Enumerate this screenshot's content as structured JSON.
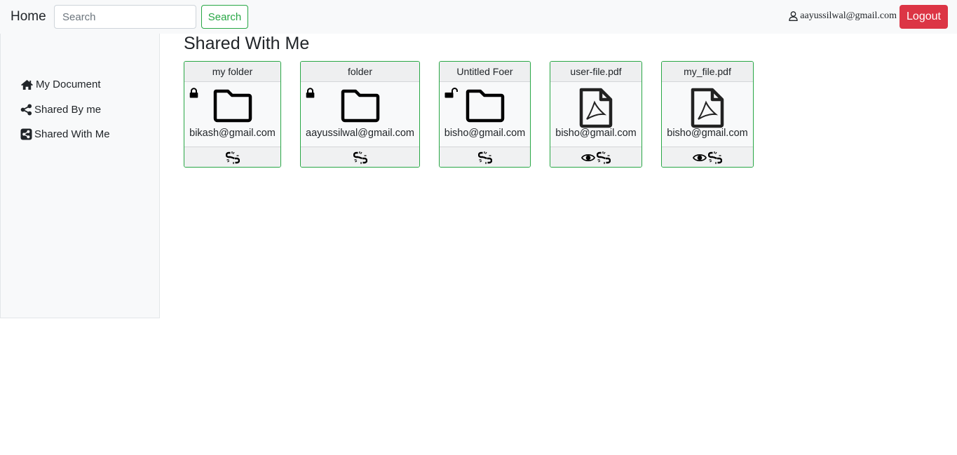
{
  "nav": {
    "brand": "Home",
    "search_placeholder": "Search",
    "search_button": "Search",
    "user_email": "aayussilwal@gmail.com",
    "logout_button": "Logout"
  },
  "sidebar": {
    "items": [
      {
        "label": "My Document",
        "icon": "home-icon"
      },
      {
        "label": "Shared By me",
        "icon": "share-icon"
      },
      {
        "label": "Shared With Me",
        "icon": "share-square-icon"
      }
    ]
  },
  "main": {
    "title": "Shared With Me",
    "cards": [
      {
        "name": "my folder",
        "owner": "bikash@gmail.com",
        "type": "folder",
        "lock": "locked-icon",
        "actions": [
          "unlink-icon"
        ]
      },
      {
        "name": "folder",
        "owner": "aayussilwal@gmail.com",
        "type": "folder",
        "lock": "locked-icon",
        "actions": [
          "unlink-icon"
        ]
      },
      {
        "name": "Untitled Foer",
        "owner": "bisho@gmail.com",
        "type": "folder",
        "lock": "unlocked-icon",
        "actions": [
          "unlink-icon"
        ]
      },
      {
        "name": "user-file.pdf",
        "owner": "bisho@gmail.com",
        "type": "pdf",
        "lock": "",
        "actions": [
          "eye-icon",
          "unlink-icon"
        ]
      },
      {
        "name": "my_file.pdf",
        "owner": "bisho@gmail.com",
        "type": "pdf",
        "lock": "",
        "actions": [
          "eye-icon",
          "unlink-icon"
        ]
      }
    ]
  },
  "colors": {
    "card_border": "#28a745",
    "logout": "#dc3545",
    "navbar_bg": "#f8f9fa"
  }
}
